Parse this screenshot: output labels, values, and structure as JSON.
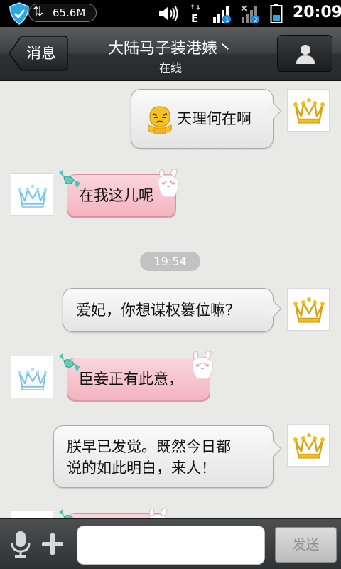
{
  "status_bar": {
    "memory": "65.6M",
    "network_type": "E",
    "time": "20:09",
    "icons": [
      "shield-icon",
      "sync-arrows-icon",
      "volume-icon",
      "edge-network-icon",
      "signal-sim1-icon",
      "signal-sim2-icon",
      "battery-icon"
    ]
  },
  "header": {
    "back_label": "消息",
    "title": "大陆马子装港婊丶",
    "status": "在线",
    "profile_icon": "person-icon"
  },
  "messages": [
    {
      "side": "out",
      "text": "天理何在啊",
      "emoji": "annoyed-face-icon"
    },
    {
      "side": "in",
      "text": "在我这儿呢"
    },
    {
      "side": "out",
      "text": "爱妃，你想谋权篡位嘛？"
    },
    {
      "side": "in",
      "text": "臣妾正有此意，"
    },
    {
      "side": "out",
      "lines": [
        "朕早已发觉。既然今日都",
        "说的如此明白，来人！"
      ]
    }
  ],
  "time_separator": "19:54",
  "composer": {
    "input_value": "",
    "send_label": "发送",
    "mic_icon": "microphone-icon",
    "plus_icon": "plus-icon"
  },
  "colors": {
    "incoming_bubble": "#f7c3cd",
    "outgoing_bubble": "#eeeeee",
    "chat_background": "#e9eae7",
    "header": "#2e3032"
  }
}
